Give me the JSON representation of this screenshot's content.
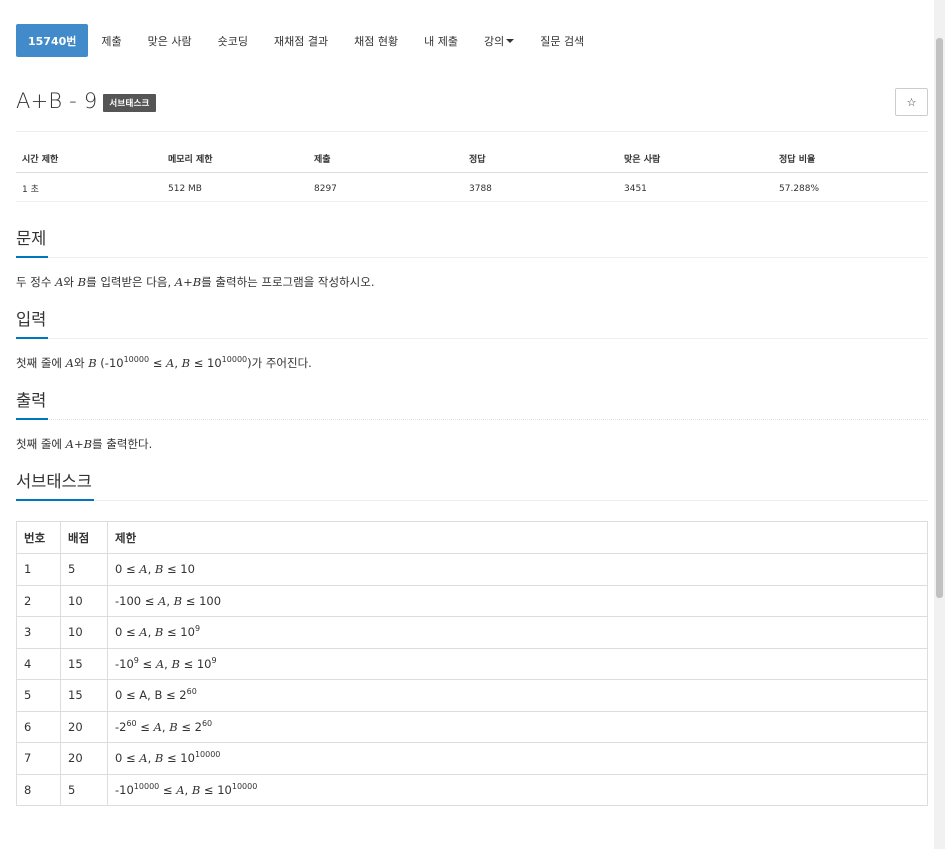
{
  "tabs": [
    {
      "label": "15740번",
      "active": true
    },
    {
      "label": "제출"
    },
    {
      "label": "맞은 사람"
    },
    {
      "label": "숏코딩"
    },
    {
      "label": "재채점 결과"
    },
    {
      "label": "채점 현황"
    },
    {
      "label": "내 제출"
    },
    {
      "label": "강의"
    },
    {
      "label": "질문 검색"
    }
  ],
  "problem": {
    "title": "A+B - 9",
    "badge": "서브태스크",
    "star_icon": "☆"
  },
  "info": {
    "headers": [
      "시간 제한",
      "메모리 제한",
      "제출",
      "정답",
      "맞은 사람",
      "정답 비율"
    ],
    "values": [
      "1 초",
      "512 MB",
      "8297",
      "3788",
      "3451",
      "57.288%"
    ]
  },
  "sections": {
    "problem": {
      "title": "문제",
      "parts": [
        "두 정수 ",
        "A",
        "와 ",
        "B",
        "를 입력받은 다음, ",
        "A+B",
        "를 출력하는 프로그램을 작성하시오."
      ]
    },
    "input": {
      "title": "입력",
      "parts": [
        "첫째 줄에 ",
        "A",
        "와 ",
        "B",
        " (-10",
        "10000",
        " ≤ ",
        "A",
        ", ",
        "B",
        " ≤ 10",
        "10000",
        ")가 주어진다."
      ]
    },
    "output": {
      "title": "출력",
      "parts": [
        "첫째 줄에 ",
        "A+B",
        "를 출력한다."
      ]
    },
    "subtask": {
      "title": "서브태스크"
    }
  },
  "subtask_table": {
    "headers": [
      "번호",
      "배점",
      "제한"
    ],
    "rows": [
      {
        "num": "1",
        "score": "5",
        "limit": [
          "0 ≤ ",
          "A",
          ", ",
          "B",
          " ≤ 10"
        ]
      },
      {
        "num": "2",
        "score": "10",
        "limit": [
          "-100 ≤ ",
          "A",
          ", ",
          "B",
          " ≤ 100"
        ]
      },
      {
        "num": "3",
        "score": "10",
        "limit": [
          "0 ≤ ",
          "A",
          ", ",
          "B",
          " ≤ 10",
          "9"
        ]
      },
      {
        "num": "4",
        "score": "15",
        "limit": [
          "-10",
          "9",
          " ≤ ",
          "A",
          ", ",
          "B",
          " ≤ 10",
          "9"
        ]
      },
      {
        "num": "5",
        "score": "15",
        "limit": [
          "0 ≤ A, B ≤ 2",
          "60"
        ]
      },
      {
        "num": "6",
        "score": "20",
        "limit": [
          "-2",
          "60",
          " ≤ ",
          "A",
          ", ",
          "B",
          " ≤ 2",
          "60"
        ]
      },
      {
        "num": "7",
        "score": "20",
        "limit": [
          "0 ≤ ",
          "A",
          ", ",
          "B",
          " ≤ 10",
          "10000"
        ]
      },
      {
        "num": "8",
        "score": "5",
        "limit": [
          "-10",
          "10000",
          " ≤ ",
          "A",
          ", ",
          "B",
          " ≤ 10",
          "10000"
        ]
      }
    ]
  }
}
